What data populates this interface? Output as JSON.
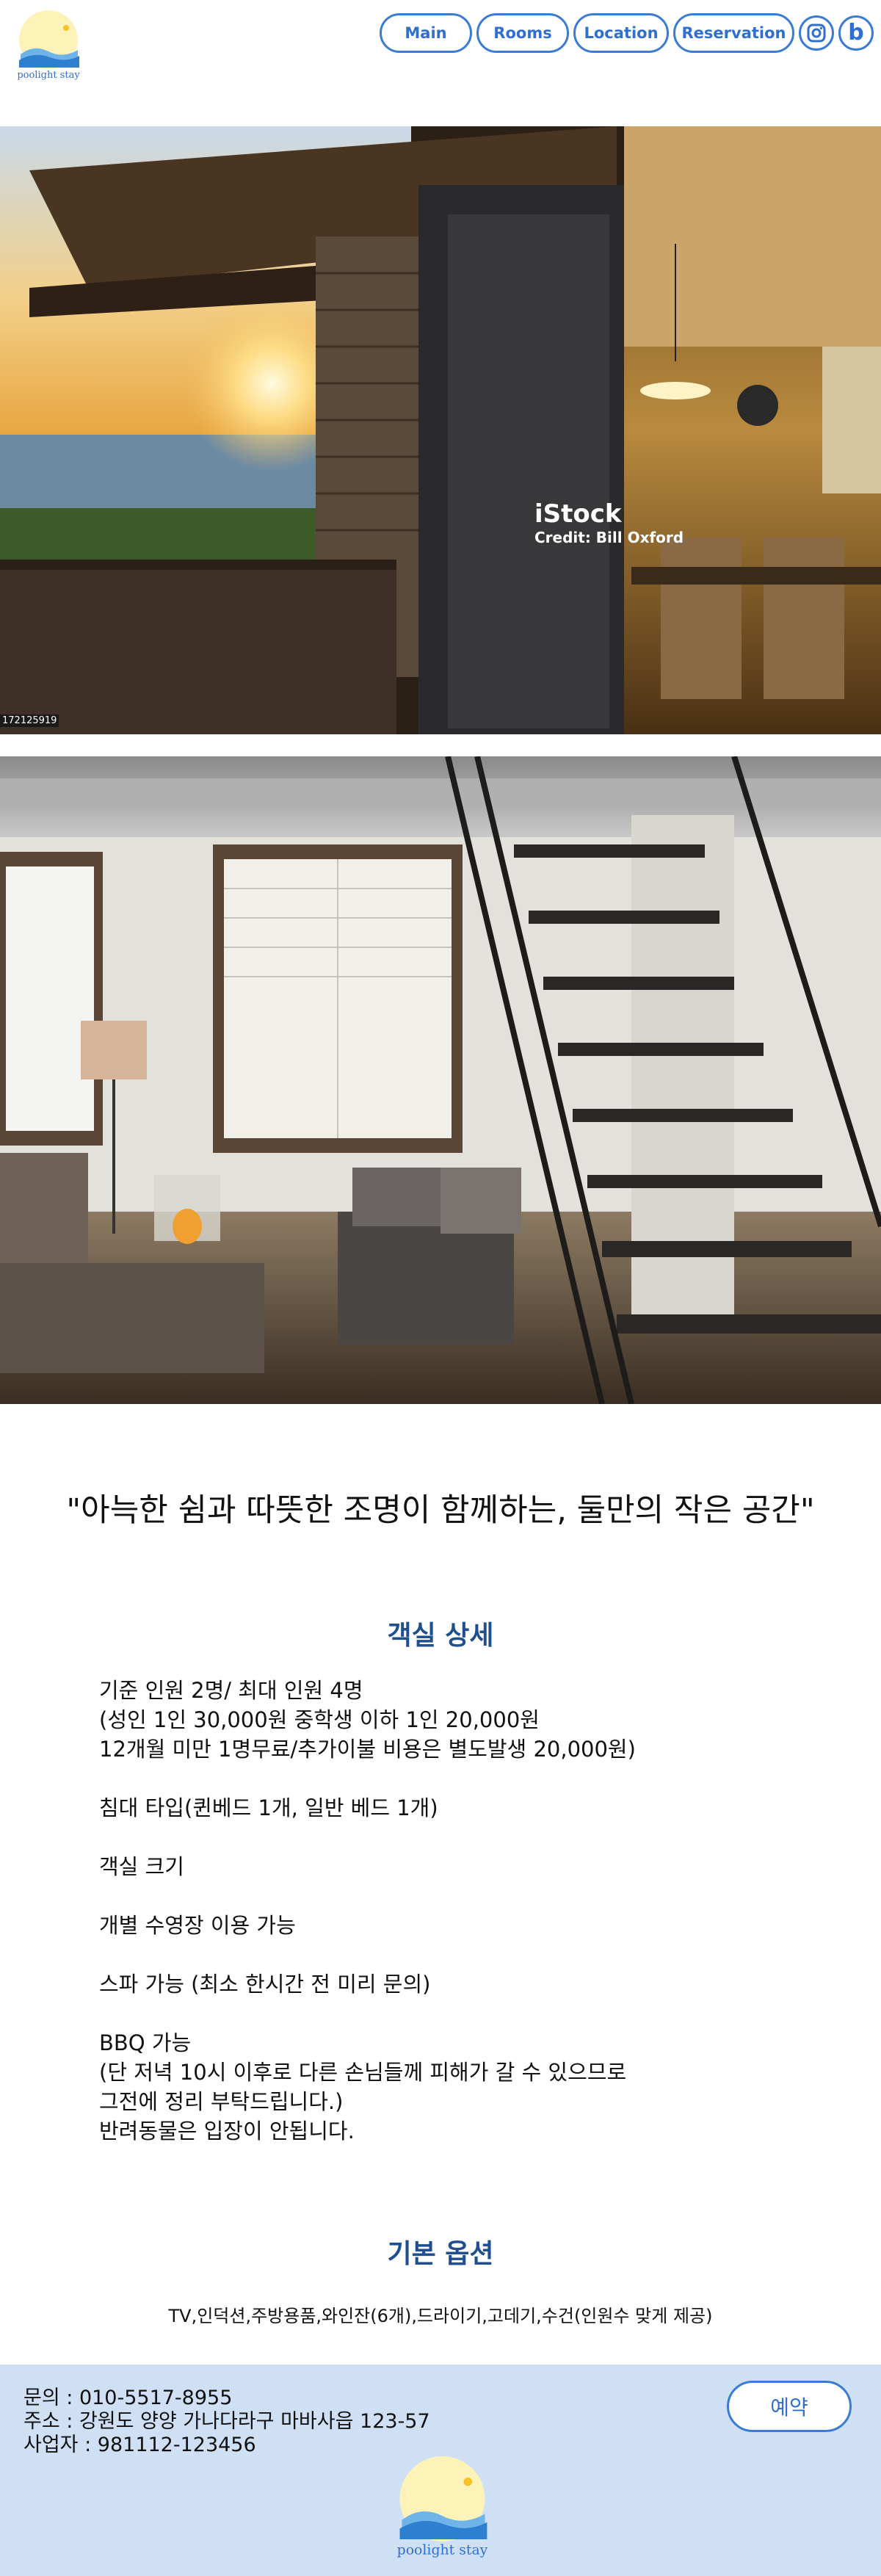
{
  "brand": {
    "logo_text": "poolight stay"
  },
  "nav": {
    "main": "Main",
    "rooms": "Rooms",
    "location": "Location",
    "reservation": "Reservation",
    "instagram_icon": "instagram-icon",
    "blog_letter": "b"
  },
  "hero": {
    "watermark_brand": "iStock",
    "watermark_credit": "Credit: Bill Oxford",
    "watermark_id": "172125919"
  },
  "quote": "\"아늑한 쉼과 따뜻한 조명이 함께하는, 둘만의 작은 공간\"",
  "room_details": {
    "title": "객실 상세",
    "capacity": "기준 인원 2명/ 최대 인원 4명\n(성인 1인 30,000원 중학생 이하 1인 20,000원\n12개월 미만 1명무료/추가이불 비용은 별도발생 20,000원)",
    "bed": "침대 타입(퀸베드 1개, 일반 베드 1개)",
    "size": "객실 크기",
    "pool": "개별 수영장 이용 가능",
    "spa": "스파 가능 (최소 한시간 전 미리 문의)",
    "bbq": "BBQ 가능\n(단 저녁 10시 이후로 다른 손님들께 피해가 갈 수 있으므로\n그전에 정리 부탁드립니다.)\n반려동물은 입장이 안됩니다."
  },
  "basic_options": {
    "title": "기본 옵션",
    "items": "TV,인덕션,주방용품,와인잔(6개),드라이기,고데기,수건(인원수 맞게 제공)"
  },
  "footer": {
    "contact": "문의 : 010-5517-8955",
    "address": "주소 : 강원도 양양 가나다라구 마바사읍 123-57",
    "business": "사업자 : 981112-123456",
    "reserve_label": "예약",
    "logo_text": "poolight stay"
  },
  "colors": {
    "accent": "#3a7bd5",
    "title_blue": "#1f4f8f",
    "footer_bg": "#cfe0f5"
  }
}
